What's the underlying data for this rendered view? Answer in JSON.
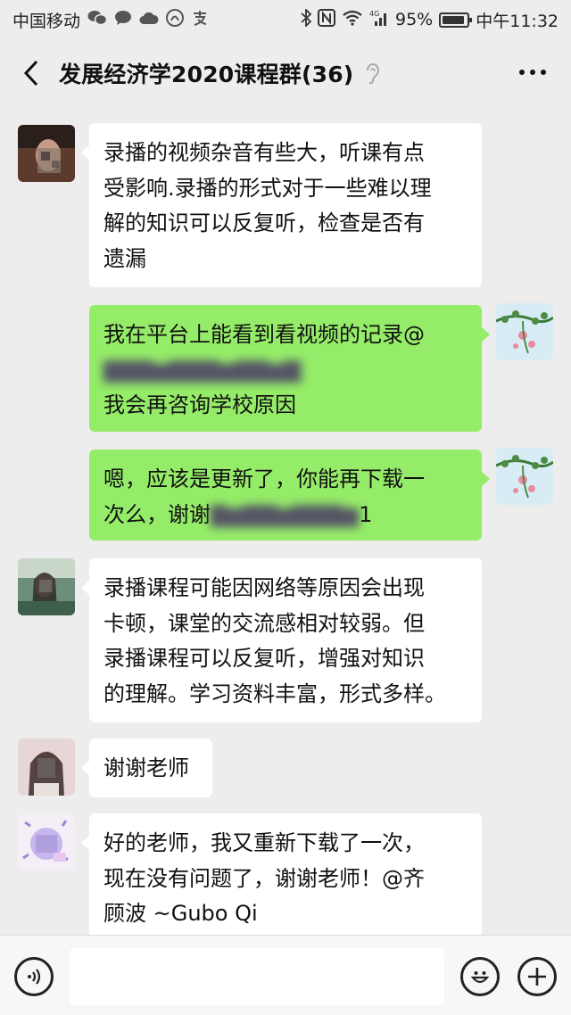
{
  "status_bar": {
    "carrier": "中国移动",
    "battery_percent": "95%",
    "time": "中午11:32",
    "network": "4G"
  },
  "header": {
    "title": "发展经济学2020课程群(36)"
  },
  "messages": [
    {
      "direction": "incoming",
      "lines": [
        "录播的视频杂音有些大，听课有点",
        "受影响.录播的形式对于一些难以理",
        "解的知识可以反复听，检查是否有",
        "遗漏"
      ]
    },
    {
      "direction": "outgoing",
      "lines": [
        "我在平台上能看到看视频的记录@",
        "",
        "我会再咨询学校原因"
      ]
    },
    {
      "direction": "outgoing",
      "lines": [
        "嗯，应该是更新了，你能再下载一",
        "次么，谢谢"
      ],
      "tail": "1"
    },
    {
      "direction": "incoming",
      "lines": [
        "录播课程可能因网络等原因会出现",
        "卡顿，课堂的交流感相对较弱。但",
        "录播课程可以反复听，增强对知识",
        "的理解。学习资料丰富，形式多样。"
      ]
    },
    {
      "direction": "incoming",
      "lines": [
        "谢谢老师"
      ]
    },
    {
      "direction": "incoming",
      "lines": [
        "好的老师，我又重新下载了一次，",
        "现在没有问题了，谢谢老师！@齐",
        "顾波 ~Gubo Qi"
      ]
    }
  ],
  "colors": {
    "background": "#ededed",
    "incoming_bubble": "#ffffff",
    "outgoing_bubble": "#95ec69",
    "input_bar": "#f7f7f7"
  },
  "icons": {
    "back": "chevron-left-icon",
    "mute": "ear-icon",
    "more": "more-dots-icon",
    "voice": "voice-icon",
    "emoji": "emoji-icon",
    "plus": "plus-icon"
  }
}
